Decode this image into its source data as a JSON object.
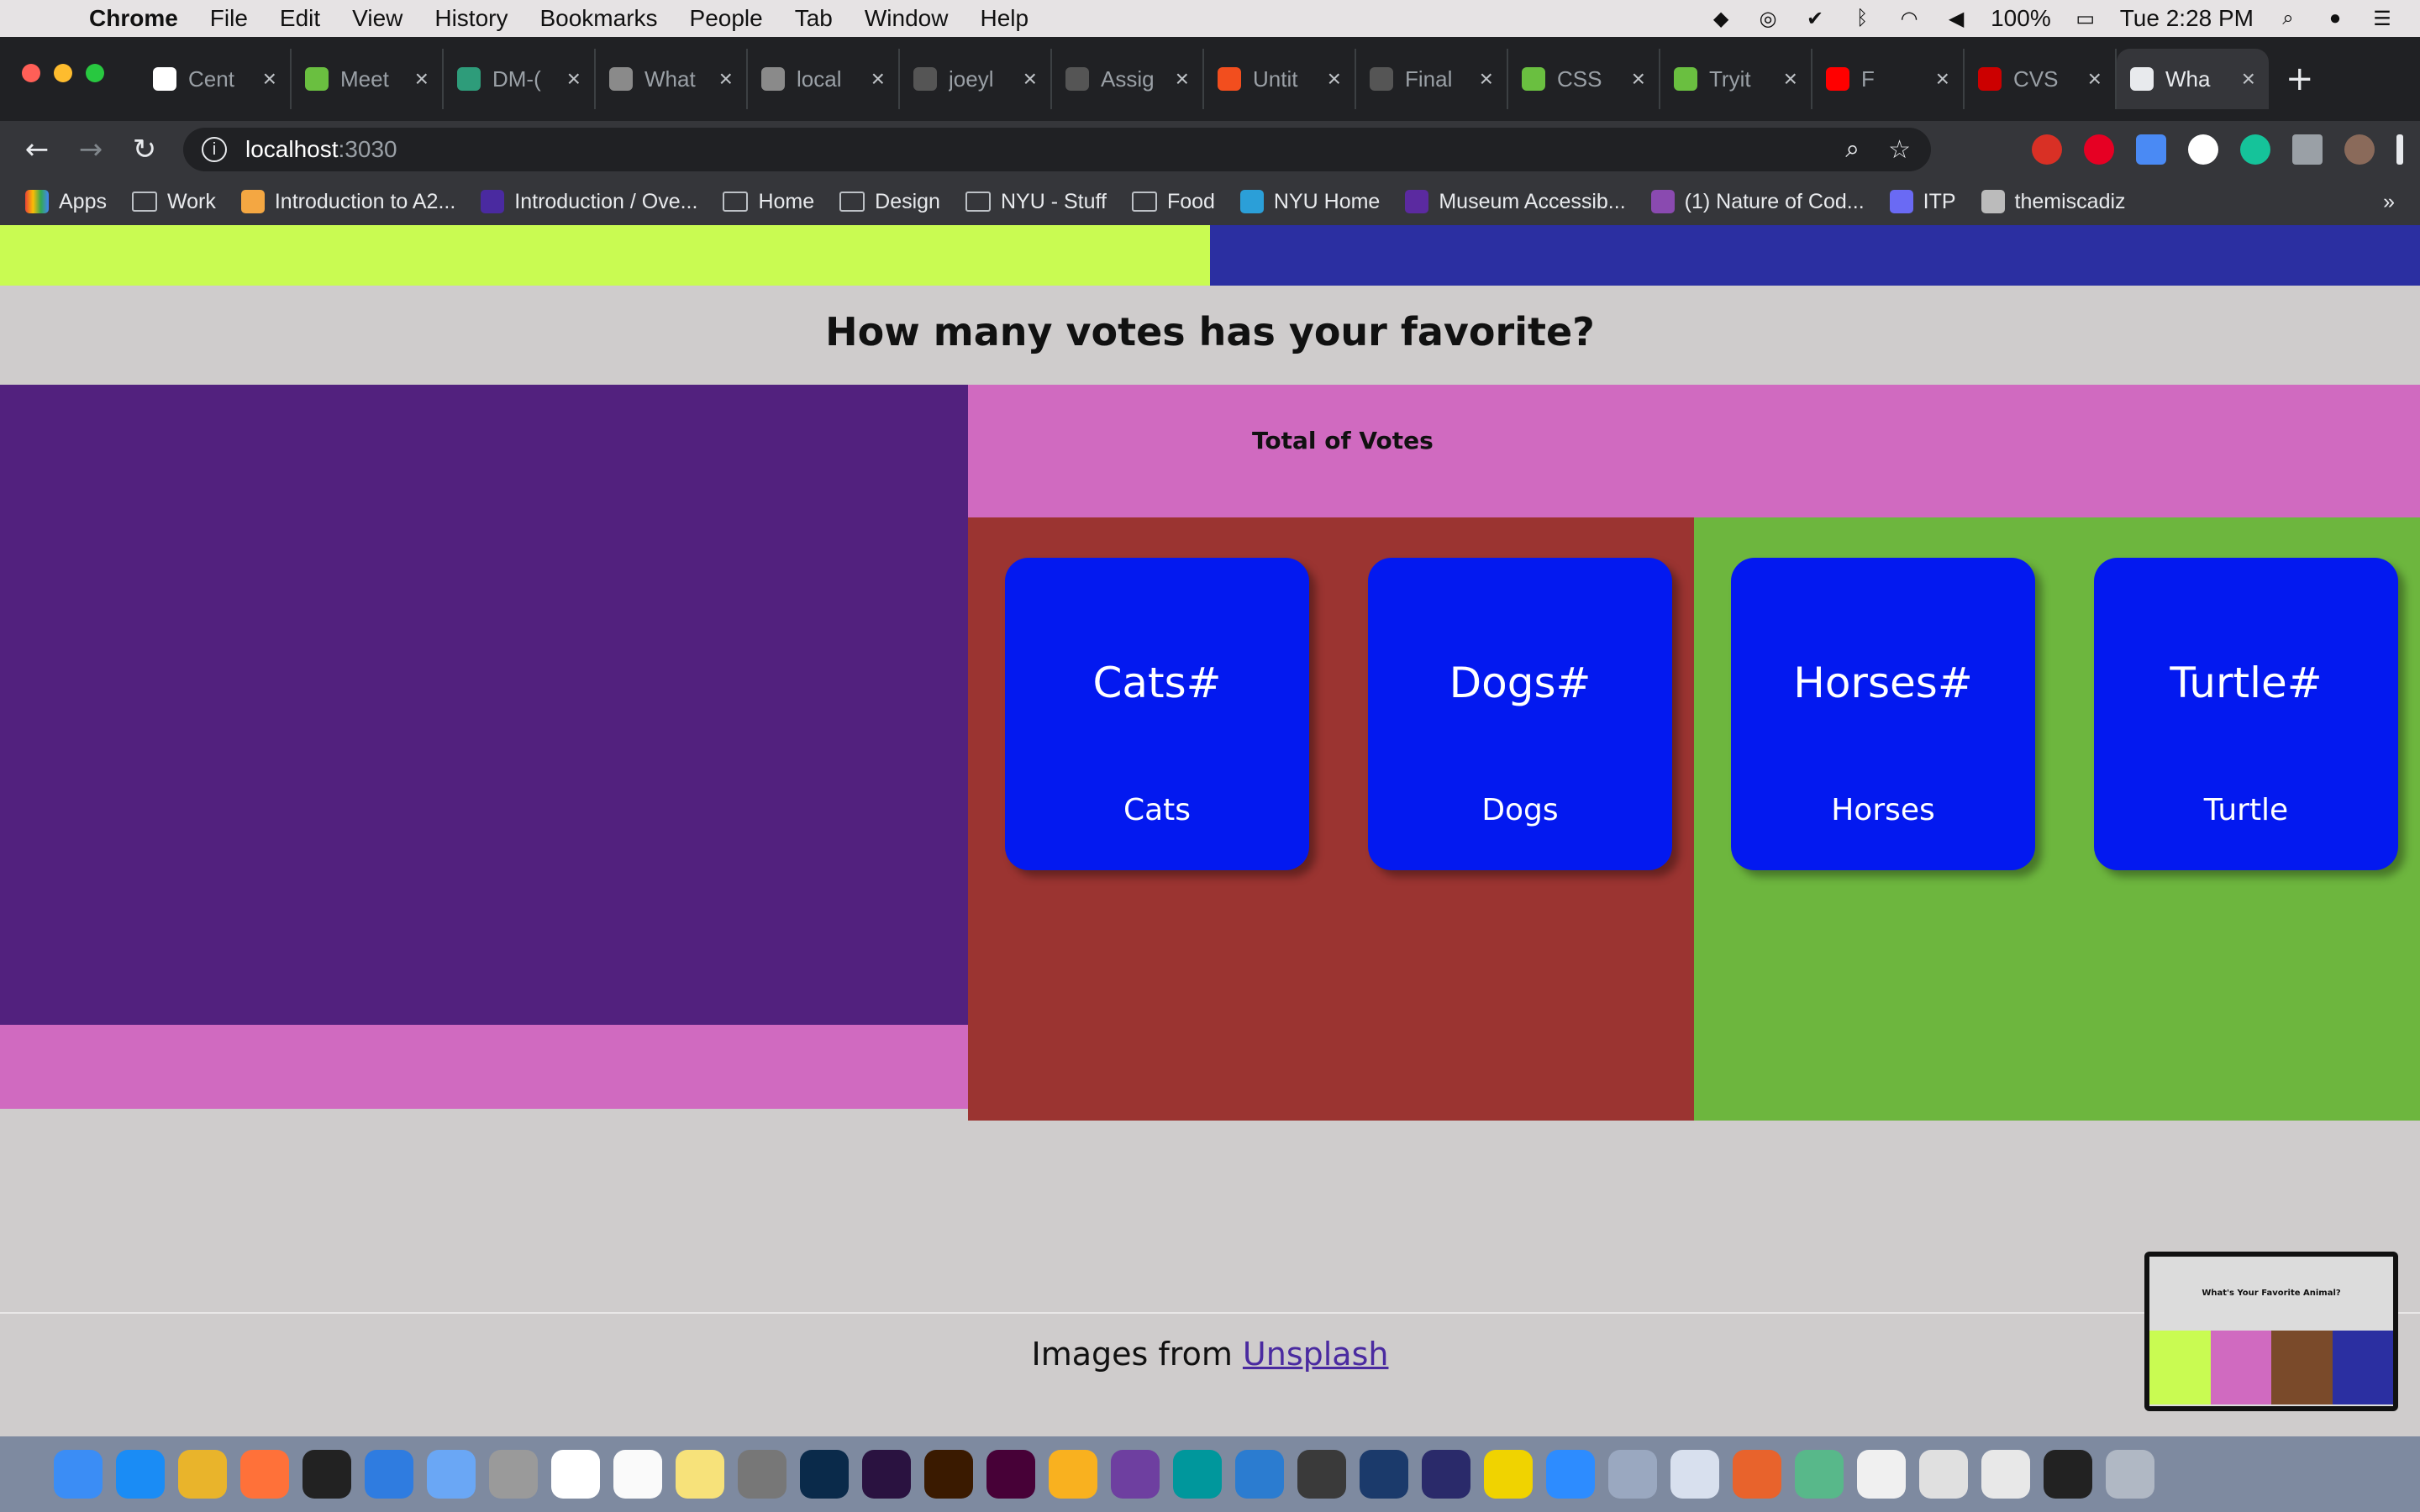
{
  "menubar": {
    "app_name": "Chrome",
    "items": [
      "File",
      "Edit",
      "View",
      "History",
      "Bookmarks",
      "People",
      "Tab",
      "Window",
      "Help"
    ],
    "battery": "100%",
    "clock": "Tue 2:28 PM"
  },
  "tabs": [
    {
      "title": "Cent",
      "color": "#ffffff"
    },
    {
      "title": "Meet",
      "color": "#6abf40"
    },
    {
      "title": "DM-(",
      "color": "#2e9c7a"
    },
    {
      "title": "What",
      "color": "#8a8a8a"
    },
    {
      "title": "local",
      "color": "#8a8a8a"
    },
    {
      "title": "joeyl",
      "color": "#555555"
    },
    {
      "title": "Assig",
      "color": "#555555"
    },
    {
      "title": "Untit",
      "color": "#f24e1e"
    },
    {
      "title": "Final",
      "color": "#555555"
    },
    {
      "title": "CSS",
      "color": "#6abf40"
    },
    {
      "title": "Tryit",
      "color": "#6abf40"
    },
    {
      "title": "F",
      "color": "#ff0000"
    },
    {
      "title": "CVS",
      "color": "#cc0000"
    },
    {
      "title": "Wha",
      "color": "#e8eaed"
    }
  ],
  "omnibox": {
    "host": "localhost",
    "port": ":3030"
  },
  "bookmarks": [
    {
      "label": "Apps",
      "kind": "apps"
    },
    {
      "label": "Work",
      "kind": "folder"
    },
    {
      "label": "Introduction to A2...",
      "kind": "site"
    },
    {
      "label": "Introduction / Ove...",
      "kind": "site"
    },
    {
      "label": "Home",
      "kind": "folder"
    },
    {
      "label": "Design",
      "kind": "folder"
    },
    {
      "label": "NYU - Stuff",
      "kind": "folder"
    },
    {
      "label": "Food",
      "kind": "folder"
    },
    {
      "label": "NYU Home",
      "kind": "site"
    },
    {
      "label": "Museum Accessib...",
      "kind": "site"
    },
    {
      "label": "(1) Nature of Cod...",
      "kind": "site"
    },
    {
      "label": "ITP",
      "kind": "site"
    },
    {
      "label": "themiscadiz",
      "kind": "site"
    }
  ],
  "page": {
    "heading": "How many votes has your favorite?",
    "total_label": "Total of Votes",
    "cards": [
      {
        "count": "Cats#",
        "label": "Cats"
      },
      {
        "count": "Dogs#",
        "label": "Dogs"
      },
      {
        "count": "Horses#",
        "label": "Horses"
      },
      {
        "count": "Turtle#",
        "label": "Turtle"
      }
    ],
    "footer_prefix": "Images from ",
    "footer_link": "Unsplash",
    "colors": {
      "lime": "#c9fb52",
      "navy": "#2b2fa1",
      "purple": "#52217e",
      "pink": "#d06ac0",
      "red": "#9b3431",
      "green": "#6db63e",
      "card_blue": "#0319f0"
    }
  },
  "thumbnail": {
    "title": "What's Your Favorite Animal?"
  }
}
